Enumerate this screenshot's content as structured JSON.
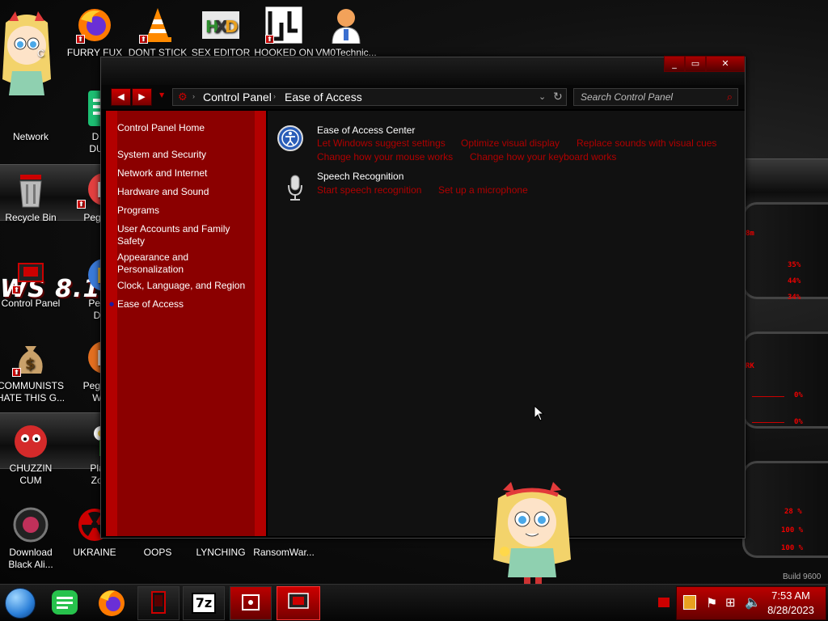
{
  "desktop": {
    "icons": [
      {
        "label": "C",
        "icon": "cartoon-character-icon"
      },
      {
        "label": "FURRY FUX",
        "icon": "firefox-icon"
      },
      {
        "label": "DONT STICK",
        "icon": "vlc-cone-icon"
      },
      {
        "label": "SEX EDITOR",
        "icon": "hex-editor-icon"
      },
      {
        "label": "HOOKED ON",
        "icon": "maze-icon"
      },
      {
        "label": "VM0Technic...",
        "icon": "doctor-avatar-icon"
      },
      {
        "label": "Network",
        "icon": "network-icon"
      },
      {
        "label": "D FO DUMB",
        "icon": "green-document-icon"
      },
      {
        "label": "Recycle Bin",
        "icon": "recycle-bin-icon"
      },
      {
        "label": "Peggle D",
        "icon": "peggle-icon"
      },
      {
        "label": "Control Panel",
        "icon": "control-panel-icon"
      },
      {
        "label": "Peggle Delu",
        "icon": "peggle-icon"
      },
      {
        "label": "COMMUNISTS HATE THIS G...",
        "icon": "money-bag-icon"
      },
      {
        "label": "Peggle of Warc",
        "icon": "peggle-icon"
      },
      {
        "label": "CHUZZIN CUM",
        "icon": "chuzzle-icon"
      },
      {
        "label": "Plants Zomb",
        "icon": "plants-zombies-icon"
      },
      {
        "label": "Download Black Ali...",
        "icon": "black-orb-icon"
      },
      {
        "label": "UKRAINE",
        "icon": "radiation-icon"
      },
      {
        "label": "OOPS",
        "icon": "blank-icon"
      },
      {
        "label": "LYNCHING",
        "icon": "blank-icon"
      },
      {
        "label": "RansomWar...",
        "icon": "blank-icon"
      }
    ],
    "logo_text": "WS 8.1",
    "build_text": "Build 9600",
    "hud_values": [
      "35%",
      "44%",
      "34%",
      "0%",
      "0%",
      "28 %",
      "100 %",
      "100 %"
    ]
  },
  "window": {
    "breadcrumb": [
      "Control Panel",
      "Ease of Access"
    ],
    "search_placeholder": "Search Control Panel",
    "sidebar": {
      "home": "Control Panel Home",
      "items": [
        "System and Security",
        "Network and Internet",
        "Hardware and Sound",
        "Programs",
        "User Accounts and Family Safety",
        "Appearance and Personalization",
        "Clock, Language, and Region",
        "Ease of Access"
      ],
      "active_index": 7
    },
    "categories": [
      {
        "title": "Ease of Access Center",
        "icon": "ease-of-access-icon",
        "links": [
          "Let Windows suggest settings",
          "Optimize visual display",
          "Replace sounds with visual cues",
          "Change how your mouse works",
          "Change how your keyboard works"
        ]
      },
      {
        "title": "Speech Recognition",
        "icon": "microphone-icon",
        "links": [
          "Start speech recognition",
          "Set up a microphone"
        ]
      }
    ]
  },
  "taskbar": {
    "apps": [
      "start-orb-icon",
      "green-chat-icon",
      "firefox-icon",
      "red-device-icon",
      "7zip-icon",
      "red-media-icon",
      "control-panel-icon"
    ],
    "seven_zip_label": "7z",
    "clock_time": "7:53 AM",
    "clock_date": "8/28/2023"
  },
  "colors": {
    "accent": "#8b0000",
    "accent_bright": "#b30000",
    "link": "#b00000",
    "window_bg": "#111111"
  }
}
